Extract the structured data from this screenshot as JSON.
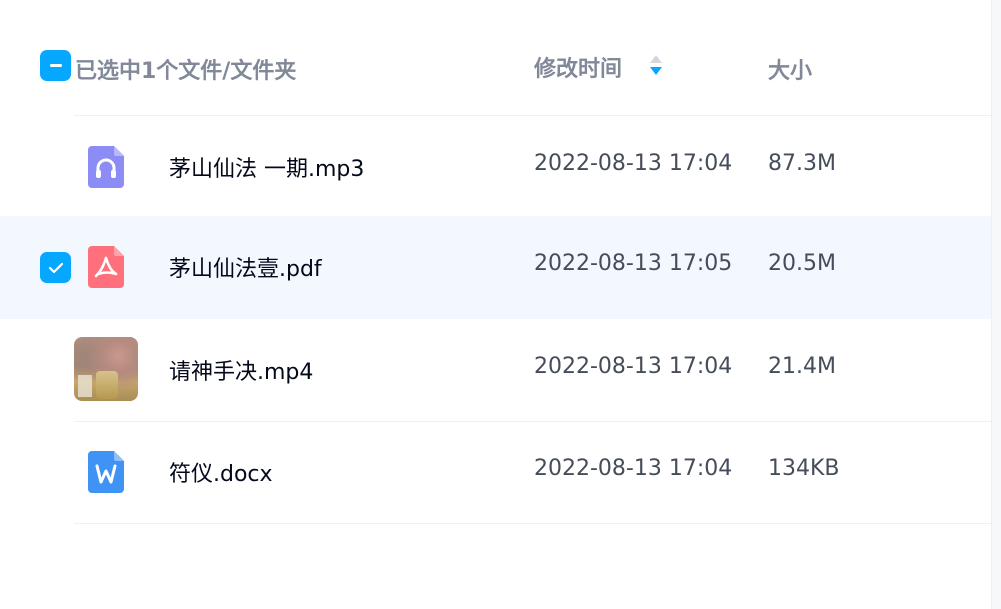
{
  "header": {
    "selection_text": "已选中1个文件/文件夹",
    "col_modified": "修改时间",
    "col_size": "大小"
  },
  "files": [
    {
      "name": "茅山仙法 一期.mp3",
      "modified": "2022-08-13 17:04",
      "size": "87.3M",
      "type": "audio",
      "selected": false
    },
    {
      "name": "茅山仙法壹.pdf",
      "modified": "2022-08-13 17:05",
      "size": "20.5M",
      "type": "pdf",
      "selected": true
    },
    {
      "name": "请神手决.mp4",
      "modified": "2022-08-13 17:04",
      "size": "21.4M",
      "type": "video",
      "selected": false
    },
    {
      "name": "符仪.docx",
      "modified": "2022-08-13 17:04",
      "size": "134KB",
      "type": "word",
      "selected": false
    }
  ],
  "colors": {
    "accent": "#06a7ff",
    "selected_row_bg": "#f2f8fe",
    "header_text": "#818999",
    "audio_icon": "#8c8cf6",
    "pdf_icon": "#ff6f7c",
    "word_icon": "#3f93f5"
  }
}
